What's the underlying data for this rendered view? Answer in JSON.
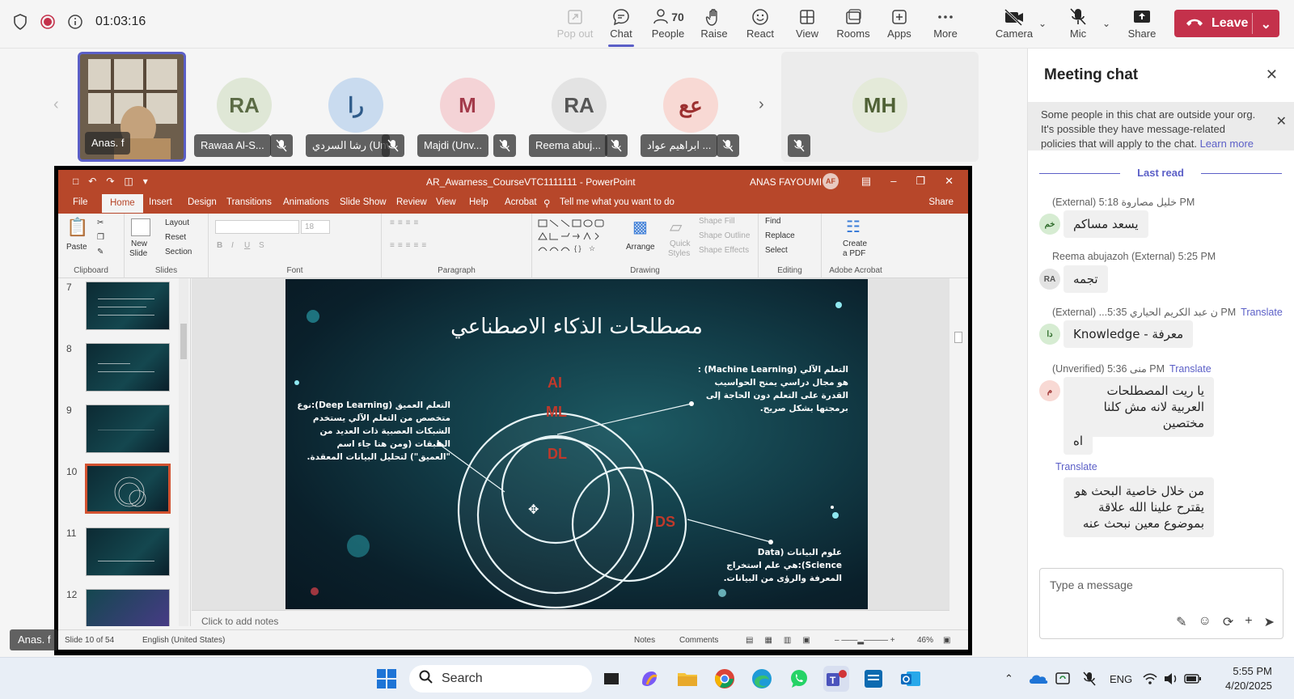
{
  "colors": {
    "accent": "#5b5fc7",
    "leave": "#c4314b",
    "powerpoint": "#b7472a",
    "slide_bg": "#123c47"
  },
  "call": {
    "timer": "01:03:16"
  },
  "toolbar": {
    "popout": "Pop out",
    "chat": "Chat",
    "people": "People",
    "people_count": "70",
    "raise": "Raise",
    "react": "React",
    "view": "View",
    "rooms": "Rooms",
    "apps": "Apps",
    "more": "More",
    "camera": "Camera",
    "mic": "Mic",
    "share": "Share",
    "leave": "Leave"
  },
  "participants": [
    {
      "name": "Anas. f",
      "initials": "",
      "color": "#b08d6a"
    },
    {
      "name": "Rawaa Al-S...",
      "initials": "RA",
      "color": "#dfe7d6"
    },
    {
      "name": "رشا السردي (Unv...",
      "initials": "را",
      "color": "#c9dbef"
    },
    {
      "name": "Majdi (Unv...",
      "initials": "M",
      "color": "#f4d3d6"
    },
    {
      "name": "Reema abuj...",
      "initials": "RA",
      "color": "#e3e3e3"
    },
    {
      "name": "ابراهيم عواد ...",
      "initials": "عع",
      "color": "#f8d9d4"
    },
    {
      "name": "",
      "initials": "MH",
      "color": "#e4ead9"
    }
  ],
  "presenter_label": "Anas. f",
  "powerpoint": {
    "title": "AR_Awarness_CourseVTC1111111 - PowerPoint",
    "user": "ANAS FAYOUMI",
    "user_initials": "AF",
    "tabs": [
      "File",
      "Home",
      "Insert",
      "Design",
      "Transitions",
      "Animations",
      "Slide Show",
      "Review",
      "View",
      "Help",
      "Acrobat"
    ],
    "tell_me": "Tell me what you want to do",
    "share": "Share",
    "ribbon": {
      "clipboard": "Clipboard",
      "paste": "Paste",
      "slides": "Slides",
      "new_slide_1": "New",
      "new_slide_2": "Slide",
      "layout": "Layout",
      "reset": "Reset",
      "section": "Section",
      "font": "Font",
      "font_size": "18",
      "paragraph": "Paragraph",
      "drawing": "Drawing",
      "arrange": "Arrange",
      "quick_styles_1": "Quick",
      "quick_styles_2": "Styles",
      "shape_fill": "Shape Fill",
      "shape_outline": "Shape Outline",
      "shape_effects": "Shape Effects",
      "editing": "Editing",
      "find": "Find",
      "replace": "Replace",
      "select": "Select",
      "acrobat_group": "Adobe Acrobat",
      "create_pdf_1": "Create",
      "create_pdf_2": "a PDF"
    },
    "thumbs": [
      "7",
      "8",
      "9",
      "10",
      "11",
      "12"
    ],
    "notes_placeholder": "Click to add notes",
    "status": {
      "slide": "Slide 10 of 54",
      "language": "English (United States)",
      "notes": "Notes",
      "comments": "Comments",
      "zoom": "46%"
    }
  },
  "slide": {
    "title": "مصطلحات الذكاء الاصطناعي",
    "ml_text": "التعلم الآلي (Machine Learning) : هو مجال دراسي يمنح الحواسيب القدرة على التعلم دون الحاجة إلى برمجتها بشكل صريح.",
    "dl_text": "التعلم العميق (Deep Learning):نوع متخصص من التعلم الآلي يستخدم الشبكات العصبية ذات العديد من الطبقات (ومن هنا جاء اسم \"العميق\") لتحليل البيانات المعقدة.",
    "ds_text": "علوم البيانات (Data Science):هي علم استخراج المعرفة والرؤى من البيانات.",
    "labels": {
      "ai": "AI",
      "ml": "ML",
      "dl": "DL",
      "ds": "DS"
    }
  },
  "chat": {
    "title": "Meeting chat",
    "banner": "Some people in this chat are outside your org. It's possible they have message-related policies that will apply to the chat.",
    "learn_more": "Learn more",
    "last_read": "Last read",
    "translate": "Translate",
    "messages": [
      {
        "author": "(External) خليل مصاروة",
        "time": "5:18 PM",
        "initials": "خم",
        "text": "يسعد مساكم"
      },
      {
        "author": "Reema abujazoh (External)",
        "time": "5:25 PM",
        "initials": "RA",
        "text": "تجمه"
      },
      {
        "author": "(External) ...ن عبد الكريم الحياري",
        "time": "5:35 PM",
        "initials": "دا",
        "text": "Knowledge - معرفة"
      },
      {
        "author": "(Unverified) منى",
        "time": "5:36 PM",
        "initials": "م",
        "text": "يا ريت المصطلحات العربية لانه مش كلنا مختصين"
      },
      {
        "text": "اه"
      },
      {
        "text": "من خلال خاصية البحث هو يقترح علينا الله علاقة بموضوع معين نبحث عنه"
      }
    ],
    "compose_placeholder": "Type a message"
  },
  "taskbar": {
    "search": "Search",
    "lang": "ENG",
    "time": "5:55 PM",
    "date": "4/20/2025"
  }
}
